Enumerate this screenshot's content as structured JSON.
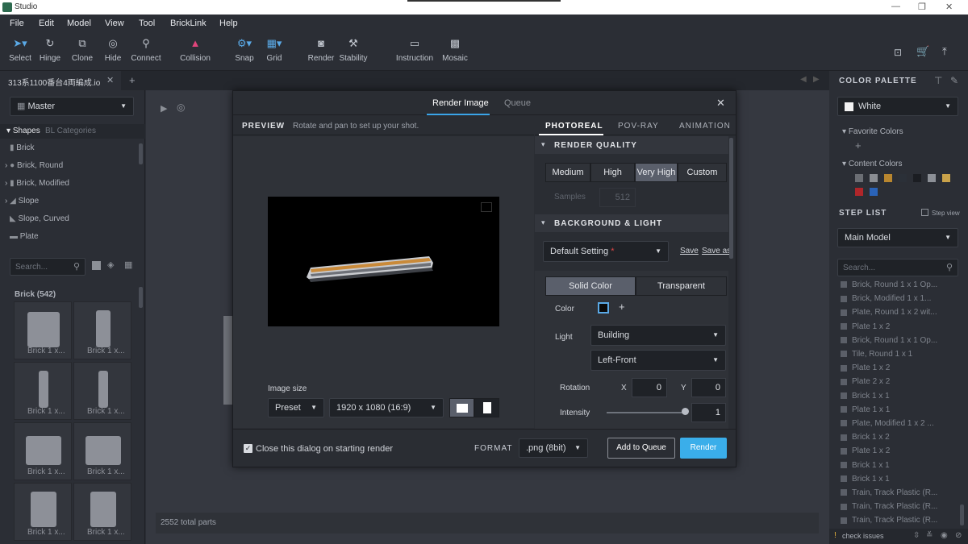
{
  "window": {
    "title": "Studio"
  },
  "menu": [
    "File",
    "Edit",
    "Model",
    "View",
    "Tool",
    "BrickLink",
    "Help"
  ],
  "toolbar": {
    "tools": [
      {
        "label": "Select",
        "icon": "arrow-cursor-icon"
      },
      {
        "label": "Hinge",
        "icon": "hinge-icon"
      },
      {
        "label": "Clone",
        "icon": "clone-icon"
      },
      {
        "label": "Hide",
        "icon": "eye-slash-icon"
      },
      {
        "label": "Connect",
        "icon": "connect-icon"
      },
      {
        "label": "Collision",
        "icon": "collision-icon"
      },
      {
        "label": "Snap",
        "icon": "snap-icon"
      },
      {
        "label": "Grid",
        "icon": "grid-icon"
      },
      {
        "label": "Render",
        "icon": "camera-icon"
      },
      {
        "label": "Stability",
        "icon": "stability-icon"
      },
      {
        "label": "Instruction",
        "icon": "instruction-icon"
      },
      {
        "label": "Mosaic",
        "icon": "mosaic-icon"
      }
    ]
  },
  "tab": {
    "name": "313系1100番台4両編成.io"
  },
  "left": {
    "palette_select": "Master",
    "tabs": {
      "shapes": "Shapes",
      "bl": "BL Categories"
    },
    "categories": [
      "Brick",
      "Brick, Round",
      "Brick, Modified",
      "Slope",
      "Slope, Curved",
      "Plate"
    ],
    "search_placeholder": "Search...",
    "group_title": "Brick (542)",
    "thumbs": [
      "Brick 1 x...",
      "Brick 1 x...",
      "Brick 1 x...",
      "Brick 1 x...",
      "Brick 1 x...",
      "Brick 1 x...",
      "Brick 1 x...",
      "Brick 1 x..."
    ]
  },
  "viewport": {
    "status": "2552 total parts"
  },
  "dialog": {
    "tabs": {
      "render": "Render Image",
      "queue": "Queue"
    },
    "preview_label": "PREVIEW",
    "preview_hint": "Rotate and pan to set up your shot.",
    "image_size_label": "Image size",
    "preset": "Preset",
    "resolution": "1920 x 1080 (16:9)",
    "close_on_render": "Close this dialog on starting render",
    "format_label": "FORMAT",
    "format": ".png (8bit)",
    "add_queue": "Add to Queue",
    "render": "Render",
    "mode_tabs": [
      "PHOTOREAL",
      "POV-RAY",
      "ANIMATION"
    ],
    "render_quality_title": "RENDER QUALITY",
    "quality": [
      "Medium",
      "High",
      "Very High",
      "Custom"
    ],
    "samples_label": "Samples",
    "samples_value": "512",
    "bg_title": "BACKGROUND & LIGHT",
    "bg_setting": "Default Setting",
    "required_mark": "*",
    "save": "Save",
    "save_as": "Save as",
    "bg_modes": [
      "Solid Color",
      "Transparent"
    ],
    "color_label": "Color",
    "light_label": "Light",
    "light_value": "Building",
    "light_dir": "Left-Front",
    "rotation_label": "Rotation",
    "x_label": "X",
    "x_value": "0",
    "y_label": "Y",
    "y_value": "0",
    "intensity_label": "Intensity",
    "intensity_value": "1"
  },
  "right": {
    "palette_title": "COLOR PALETTE",
    "color_select": "White",
    "favorite": "Favorite Colors",
    "content": "Content Colors",
    "content_swatches": [
      "#6b6e74",
      "#8a8d93",
      "#b8862f",
      "#2b3038",
      "#1b1d22",
      "#8c9097",
      "#c9a24a",
      "#b0262a",
      "#2a63b8"
    ],
    "step_title": "STEP LIST",
    "step_view": "Step view",
    "model_select": "Main Model",
    "search_placeholder": "Search...",
    "steps": [
      "Brick, Round 1 x 1 Op...",
      "Brick, Modified 1 x 1...",
      "Plate, Round 1 x 2 wit...",
      "Plate 1 x 2",
      "Brick, Round 1 x 1 Op...",
      "Tile, Round 1 x 1",
      "Plate 1 x 2",
      "Plate 2 x 2",
      "Brick 1 x 1",
      "Plate 1 x 1",
      "Plate, Modified 1 x 2 ...",
      "Brick 1 x 2",
      "Plate 1 x 2",
      "Brick 1 x 1",
      "Brick 1 x 1",
      "Train, Track Plastic (R...",
      "Train, Track Plastic (R...",
      "Train, Track Plastic (R..."
    ],
    "check_issues": "check issues"
  }
}
